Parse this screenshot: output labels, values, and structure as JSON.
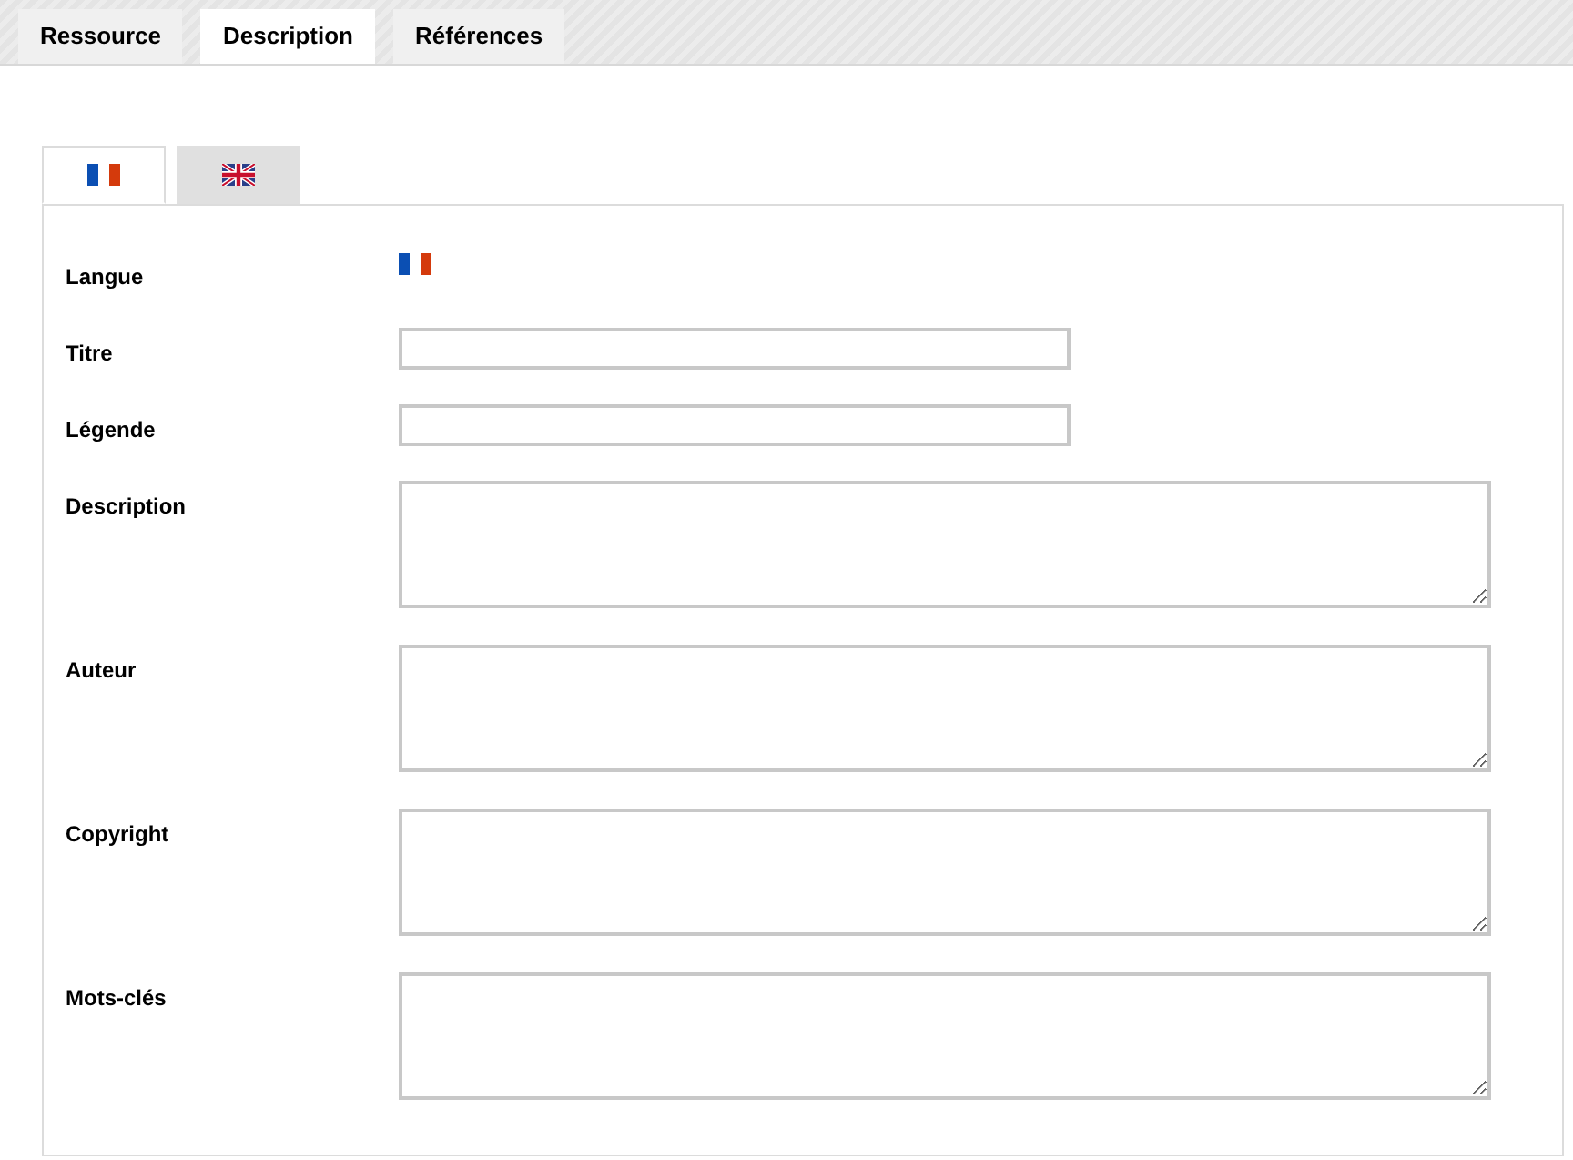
{
  "tabs": [
    {
      "label": "Ressource",
      "selected": false
    },
    {
      "label": "Description",
      "selected": true
    },
    {
      "label": "Références",
      "selected": false
    }
  ],
  "language_tabs": [
    {
      "kind": "fr",
      "selected": true
    },
    {
      "kind": "gb",
      "selected": false
    }
  ],
  "form": [
    {
      "label": "Langue",
      "kind": "flag",
      "value": {
        "kind": "fr"
      }
    },
    {
      "label": "Titre",
      "kind": "input"
    },
    {
      "label": "Légende",
      "kind": "input"
    },
    {
      "label": "Description",
      "kind": "textarea"
    },
    {
      "label": "Auteur",
      "kind": "textarea"
    },
    {
      "label": "Copyright",
      "kind": "textarea"
    },
    {
      "label": "Mots-clés",
      "kind": "textarea"
    }
  ]
}
